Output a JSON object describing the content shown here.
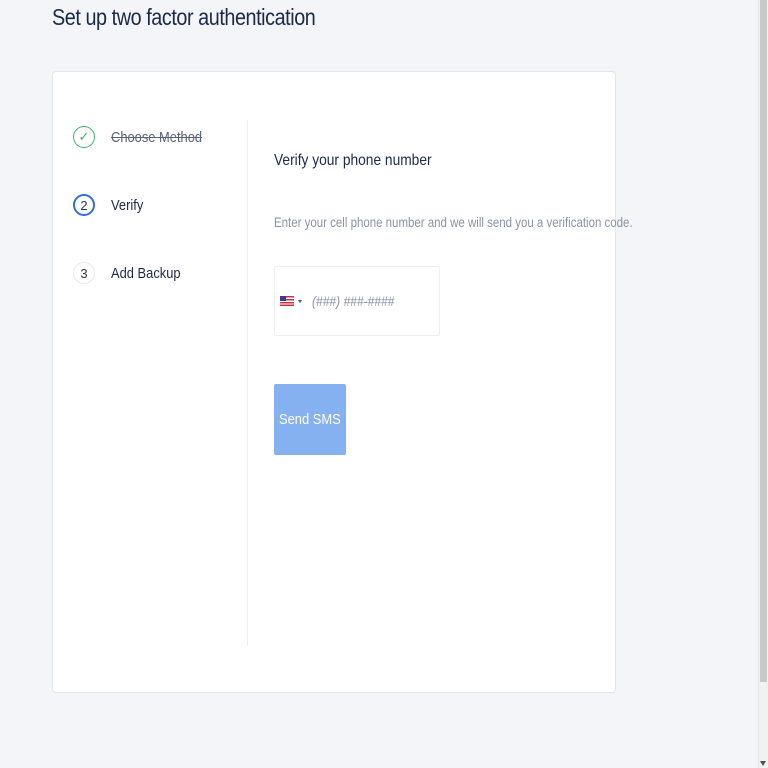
{
  "page": {
    "title": "Set up two factor authentication"
  },
  "steps": [
    {
      "number": "✓",
      "label": "Choose Method",
      "state": "completed",
      "icon": "check-icon"
    },
    {
      "number": "2",
      "label": "Verify",
      "state": "active"
    },
    {
      "number": "3",
      "label": "Add Backup",
      "state": "pending"
    }
  ],
  "verify": {
    "title": "Verify your phone number",
    "description": "Enter your cell phone number and we will send you a verification code.",
    "phone_placeholder": "(###) ###-####",
    "country_flag": "us-flag-icon",
    "send_label": "Send SMS"
  },
  "colors": {
    "completed": "#3cb371",
    "active": "#2f6fde",
    "button": "#86b1f0",
    "title": "#1b2a49",
    "muted": "#8a93a6"
  }
}
